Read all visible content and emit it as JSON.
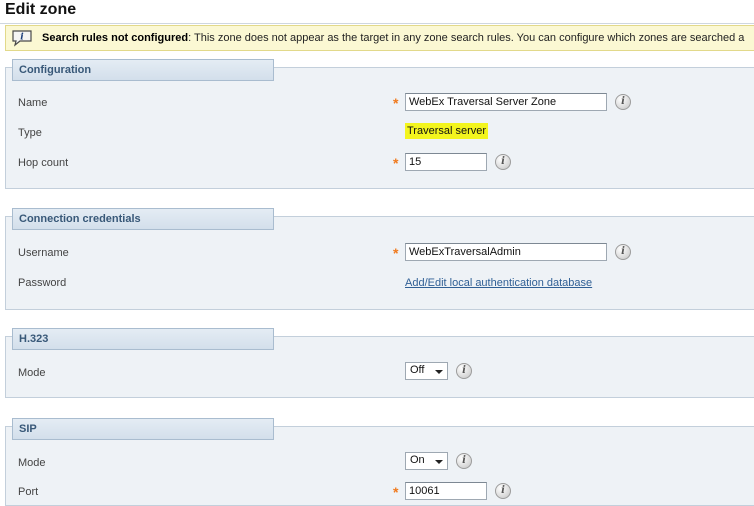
{
  "page": {
    "title": "Edit zone"
  },
  "warning": {
    "title": "Search rules not configured",
    "message": ": This zone does not appear as the target in any zone search rules. You can configure which zones are searched a"
  },
  "sections": {
    "configuration": {
      "header": "Configuration",
      "name_label": "Name",
      "name_value": "WebEx Traversal Server Zone",
      "type_label": "Type",
      "type_value": "Traversal server",
      "hop_label": "Hop count",
      "hop_value": "15"
    },
    "credentials": {
      "header": "Connection credentials",
      "username_label": "Username",
      "username_value": "WebExTraversalAdmin",
      "password_label": "Password",
      "password_link": "Add/Edit local authentication database"
    },
    "h323": {
      "header": "H.323",
      "mode_label": "Mode",
      "mode_value": "Off"
    },
    "sip": {
      "header": "SIP",
      "mode_label": "Mode",
      "mode_value": "On",
      "port_label": "Port",
      "port_value": "10061"
    }
  },
  "common": {
    "required_marker": "*",
    "info_glyph": "i"
  },
  "colors": {
    "required": "#f07a1e",
    "highlight": "#f3f51e",
    "link": "#2f5f95",
    "section_bg": "#eef2f6"
  }
}
